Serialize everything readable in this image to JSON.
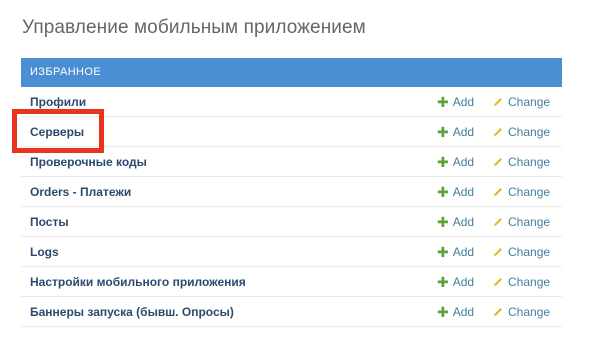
{
  "page": {
    "title": "Управление мобильным приложением"
  },
  "module": {
    "header": "ИЗБРАННОЕ",
    "add_label": "Add",
    "change_label": "Change",
    "items": [
      {
        "label": "Профили"
      },
      {
        "label": "Серверы"
      },
      {
        "label": "Проверочные коды"
      },
      {
        "label": "Orders - Платежи"
      },
      {
        "label": "Посты"
      },
      {
        "label": "Logs"
      },
      {
        "label": "Настройки мобильного приложения"
      },
      {
        "label": "Баннеры запуска (бывш. Опросы)"
      }
    ]
  },
  "icons": {
    "add": "plus-icon",
    "change": "pencil-icon"
  },
  "colors": {
    "header_bg": "#4a8fd4",
    "highlight": "#e8341c",
    "add_icon": "#5ba33b",
    "change_icon": "#e8b429",
    "link": "#447e9b"
  }
}
